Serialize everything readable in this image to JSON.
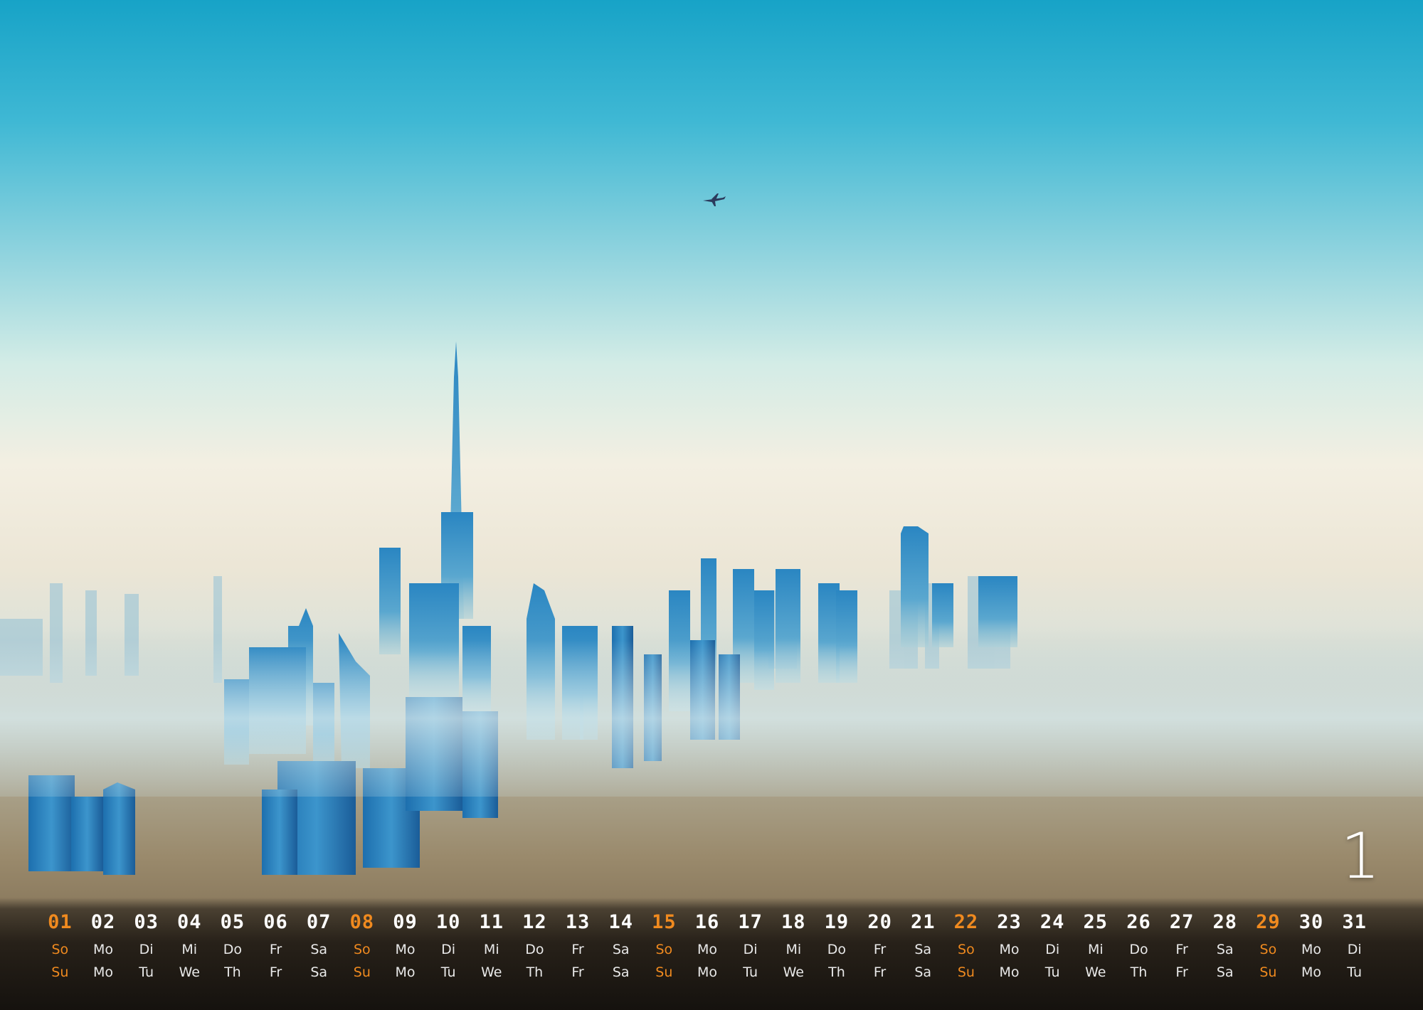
{
  "month": {
    "number": "1"
  },
  "colors": {
    "sunday": "#f08a1f",
    "text": "#ffffff",
    "sky_top": "#1ca7c9",
    "haze": "#f2efe3"
  },
  "calendar": {
    "days": [
      {
        "num": "01",
        "de": "So",
        "en": "Su",
        "sunday": true
      },
      {
        "num": "02",
        "de": "Mo",
        "en": "Mo",
        "sunday": false
      },
      {
        "num": "03",
        "de": "Di",
        "en": "Tu",
        "sunday": false
      },
      {
        "num": "04",
        "de": "Mi",
        "en": "We",
        "sunday": false
      },
      {
        "num": "05",
        "de": "Do",
        "en": "Th",
        "sunday": false
      },
      {
        "num": "06",
        "de": "Fr",
        "en": "Fr",
        "sunday": false
      },
      {
        "num": "07",
        "de": "Sa",
        "en": "Sa",
        "sunday": false
      },
      {
        "num": "08",
        "de": "So",
        "en": "Su",
        "sunday": true
      },
      {
        "num": "09",
        "de": "Mo",
        "en": "Mo",
        "sunday": false
      },
      {
        "num": "10",
        "de": "Di",
        "en": "Tu",
        "sunday": false
      },
      {
        "num": "11",
        "de": "Mi",
        "en": "We",
        "sunday": false
      },
      {
        "num": "12",
        "de": "Do",
        "en": "Th",
        "sunday": false
      },
      {
        "num": "13",
        "de": "Fr",
        "en": "Fr",
        "sunday": false
      },
      {
        "num": "14",
        "de": "Sa",
        "en": "Sa",
        "sunday": false
      },
      {
        "num": "15",
        "de": "So",
        "en": "Su",
        "sunday": true
      },
      {
        "num": "16",
        "de": "Mo",
        "en": "Mo",
        "sunday": false
      },
      {
        "num": "17",
        "de": "Di",
        "en": "Tu",
        "sunday": false
      },
      {
        "num": "18",
        "de": "Mi",
        "en": "We",
        "sunday": false
      },
      {
        "num": "19",
        "de": "Do",
        "en": "Th",
        "sunday": false
      },
      {
        "num": "20",
        "de": "Fr",
        "en": "Fr",
        "sunday": false
      },
      {
        "num": "21",
        "de": "Sa",
        "en": "Sa",
        "sunday": false
      },
      {
        "num": "22",
        "de": "So",
        "en": "Su",
        "sunday": true
      },
      {
        "num": "23",
        "de": "Mo",
        "en": "Mo",
        "sunday": false
      },
      {
        "num": "24",
        "de": "Di",
        "en": "Tu",
        "sunday": false
      },
      {
        "num": "25",
        "de": "Mi",
        "en": "We",
        "sunday": false
      },
      {
        "num": "26",
        "de": "Do",
        "en": "Th",
        "sunday": false
      },
      {
        "num": "27",
        "de": "Fr",
        "en": "Fr",
        "sunday": false
      },
      {
        "num": "28",
        "de": "Sa",
        "en": "Sa",
        "sunday": false
      },
      {
        "num": "29",
        "de": "So",
        "en": "Su",
        "sunday": true
      },
      {
        "num": "30",
        "de": "Mo",
        "en": "Mo",
        "sunday": false
      },
      {
        "num": "31",
        "de": "Di",
        "en": "Tu",
        "sunday": false
      }
    ]
  }
}
